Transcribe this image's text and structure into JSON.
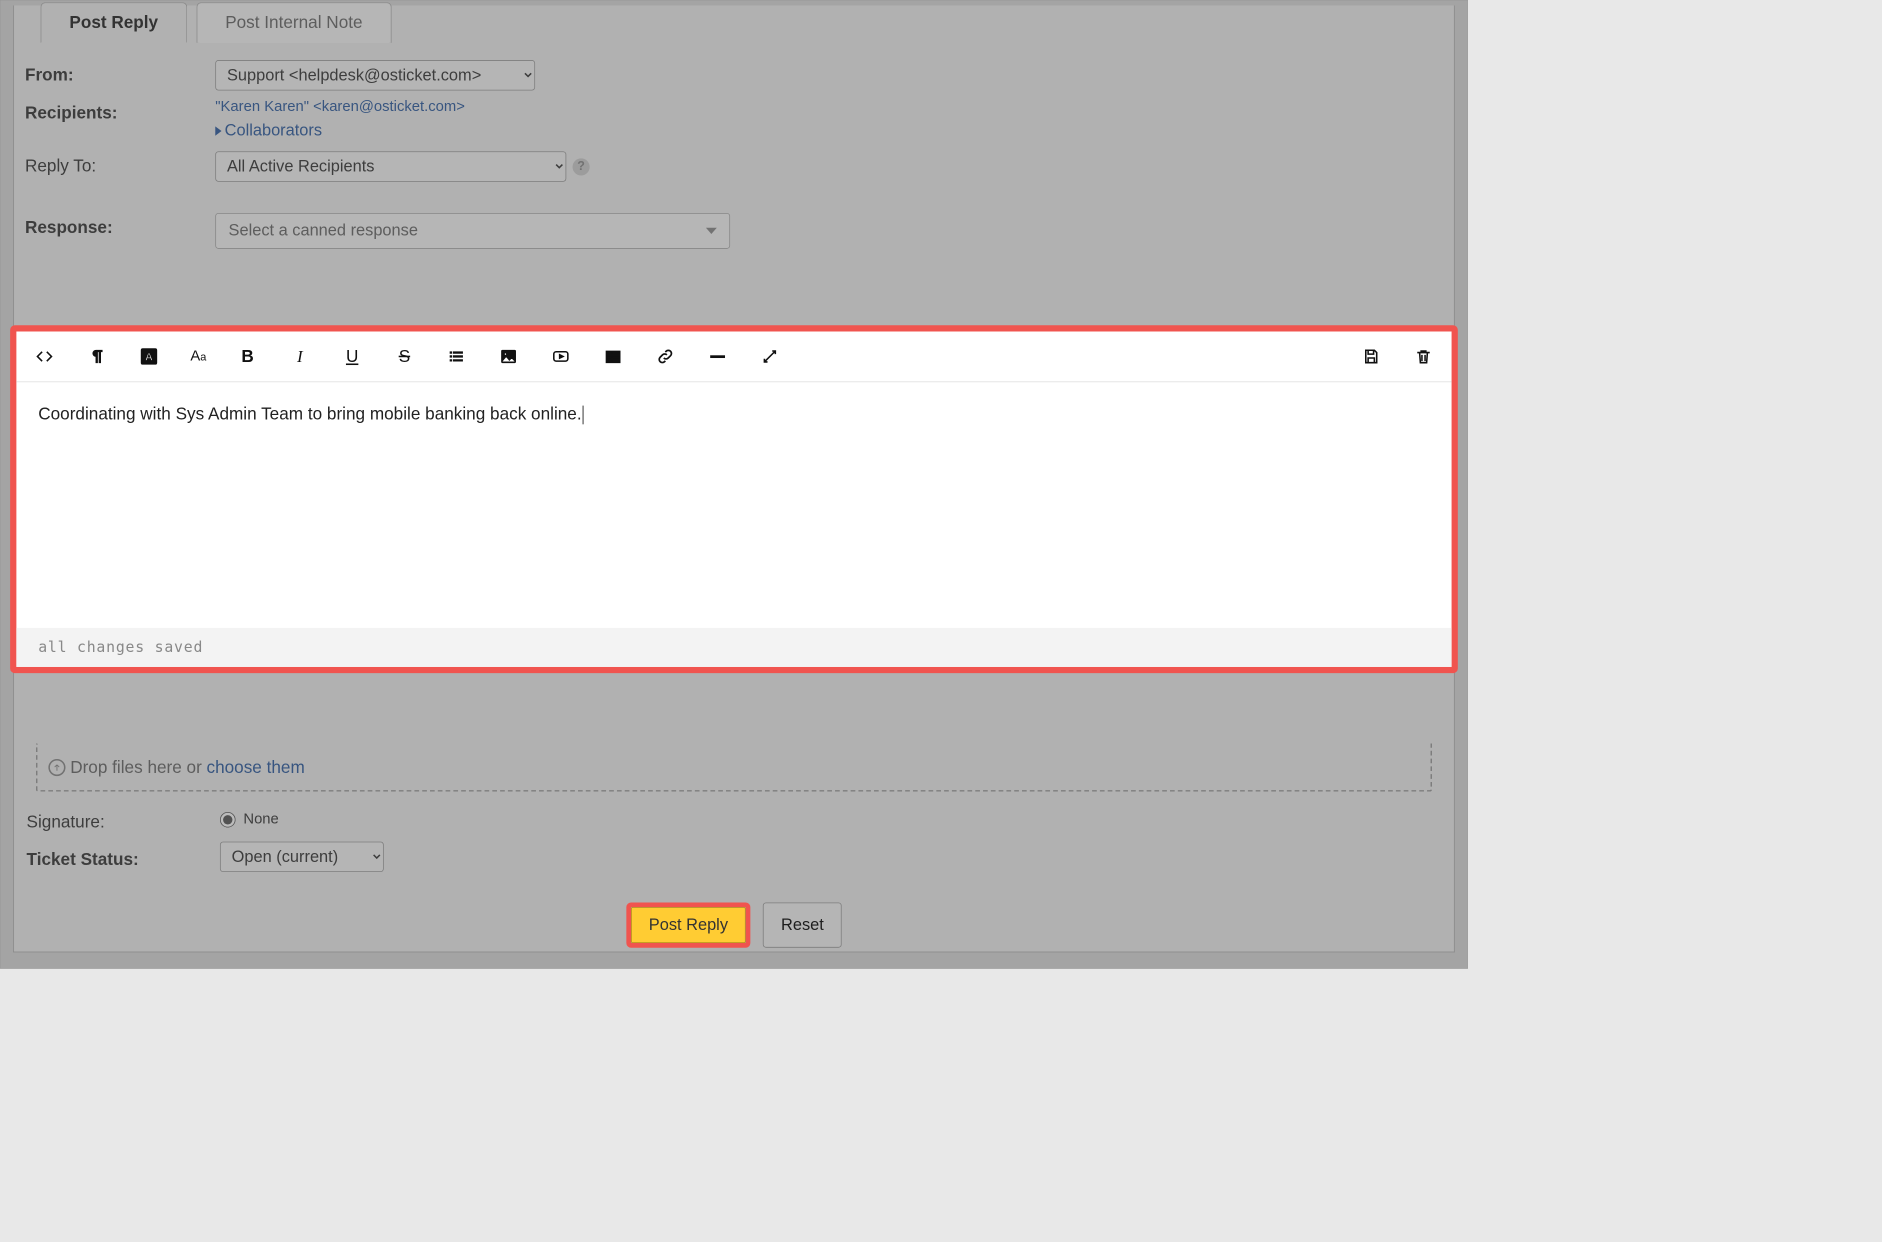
{
  "tabs": {
    "reply": "Post Reply",
    "note": "Post Internal Note"
  },
  "labels": {
    "from": "From:",
    "recipients": "Recipients:",
    "reply_to": "Reply To:",
    "response": "Response:",
    "signature": "Signature:",
    "ticket_status": "Ticket Status:",
    "drop_prefix": "Drop files here or ",
    "choose_link": "choose them",
    "collaborators": "Collaborators"
  },
  "from_options": [
    "Support <helpdesk@osticket.com>"
  ],
  "from_selected": "Support <helpdesk@osticket.com>",
  "recipients_text": "\"Karen Karen\" <karen@osticket.com>",
  "reply_to_options": [
    "All Active Recipients"
  ],
  "reply_to_selected": "All Active Recipients",
  "canned_placeholder": "Select a canned response",
  "editor": {
    "content": "Coordinating with Sys Admin Team to bring mobile banking back online.",
    "status": "all changes saved",
    "tooltips": {
      "code": "Code view",
      "paragraph": "Paragraph format",
      "bg": "Background color",
      "font_size": "Font size",
      "bold": "Bold",
      "italic": "Italic",
      "underline": "Underline",
      "strike": "Strikethrough",
      "list": "List",
      "image": "Insert image",
      "video": "Insert video",
      "table": "Insert table",
      "link": "Insert link",
      "hr": "Horizontal rule",
      "fullscreen": "Fullscreen",
      "save": "Save draft",
      "delete": "Delete draft"
    }
  },
  "signature_value": "None",
  "ticket_status_options": [
    "Open (current)"
  ],
  "ticket_status_selected": "Open (current)",
  "buttons": {
    "post_reply": "Post Reply",
    "reset": "Reset"
  }
}
